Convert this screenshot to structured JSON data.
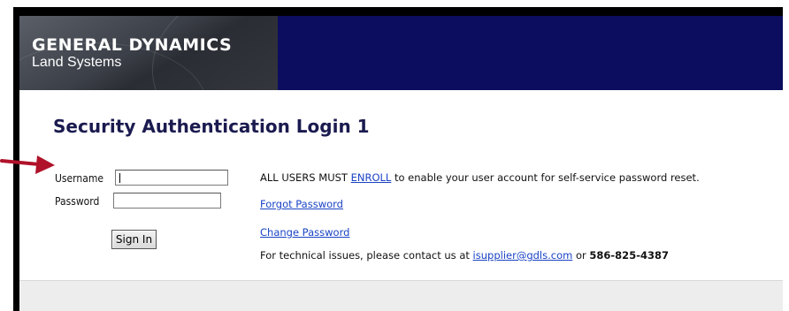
{
  "header": {
    "logo_main": "GENERAL DYNAMICS",
    "logo_sub": "Land Systems",
    "banner_color": "#0c0d5e"
  },
  "page_title": "Security Authentication Login 1",
  "login": {
    "username_label": "Username",
    "username_value": "",
    "password_label": "Password",
    "password_value": "",
    "signin_label": "Sign In"
  },
  "info": {
    "enroll_prefix": "ALL USERS MUST",
    "enroll_link": "ENROLL",
    "enroll_suffix": "to enable your user account for self-service password reset.",
    "forgot_password": "Forgot Password",
    "change_password": "Change Password",
    "support_prefix": "For technical issues, please contact us at",
    "support_email": "isupplier@gdls.com",
    "support_or": "or",
    "support_phone": "586-825-4387"
  },
  "annotation": {
    "arrow_color": "#b0122a",
    "icon": "red-arrow-icon"
  }
}
